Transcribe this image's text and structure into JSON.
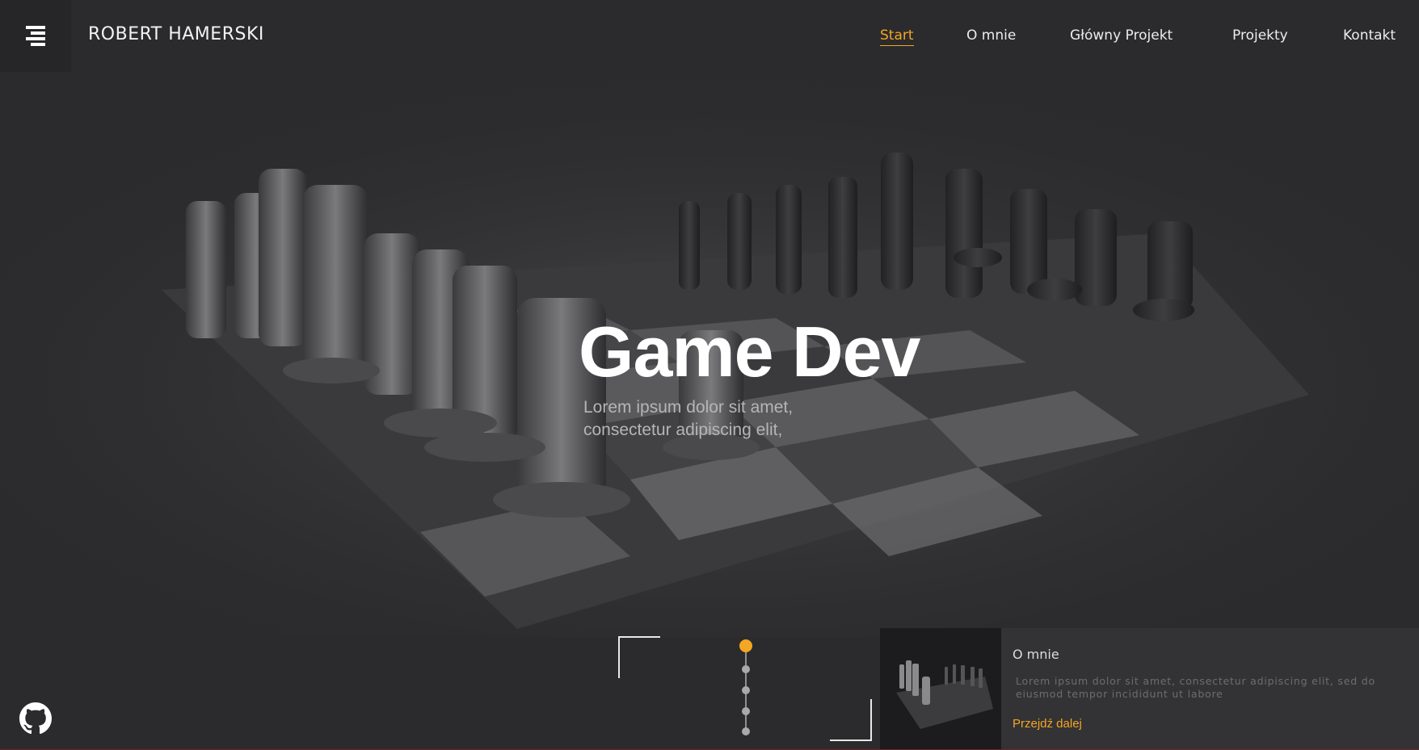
{
  "header": {
    "brand": "ROBERT HAMERSKI",
    "menu_icon": "hamburger-menu-icon",
    "nav": [
      {
        "label": "Start",
        "active": true
      },
      {
        "label": "O mnie",
        "active": false
      },
      {
        "label": "Główny Projekt",
        "active": false
      },
      {
        "label": "Projekty",
        "active": false
      },
      {
        "label": "Kontakt",
        "active": false
      }
    ]
  },
  "hero": {
    "title": "Game Dev",
    "subtitle_line1": "Lorem ipsum dolor sit amet,",
    "subtitle_line2": "consectetur adipiscing elit,"
  },
  "timeline": {
    "active_index": 0,
    "count": 5
  },
  "card": {
    "title": "O mnie",
    "text": "Lorem ipsum dolor sit amet, consectetur adipiscing elit, sed do eiusmod tempor incididunt ut labore",
    "link": "Przejdź dalej"
  },
  "footer": {
    "social_icon": "github-icon"
  },
  "colors": {
    "accent": "#f5a623",
    "background": "#2b2b2d",
    "card": "#333335"
  }
}
